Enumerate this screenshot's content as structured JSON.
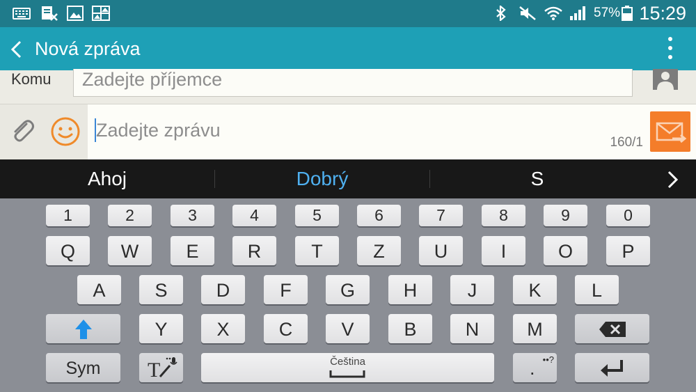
{
  "status_bar": {
    "battery_percent": "57%",
    "time": "15:29",
    "left_icons": [
      "keyboard-icon",
      "document-close-icon",
      "image-icon",
      "gallery-icon"
    ],
    "right_icons": [
      "bluetooth-icon",
      "mute-icon",
      "wifi-icon",
      "signal-icon",
      "battery-icon"
    ]
  },
  "app_bar": {
    "title": "Nová zpráva",
    "accent": "#1ea0b6"
  },
  "recipient": {
    "label": "Komu",
    "placeholder": "Zadejte příjemce"
  },
  "compose": {
    "placeholder": "Zadejte zprávu",
    "counter": "160/1",
    "send_color": "#f47d2a"
  },
  "suggestions": {
    "items": [
      {
        "text": "Ahoj",
        "color": "#ffffff"
      },
      {
        "text": "Dobrý",
        "color": "#4fb0f0"
      },
      {
        "text": "S",
        "color": "#ffffff"
      }
    ]
  },
  "keyboard": {
    "number_row": [
      "1",
      "2",
      "3",
      "4",
      "5",
      "6",
      "7",
      "8",
      "9",
      "0"
    ],
    "row1": [
      "Q",
      "W",
      "E",
      "R",
      "T",
      "Z",
      "U",
      "I",
      "O",
      "P"
    ],
    "row2": [
      "A",
      "S",
      "D",
      "F",
      "G",
      "H",
      "J",
      "K",
      "L"
    ],
    "row3": [
      "Y",
      "X",
      "C",
      "V",
      "B",
      "N",
      "M"
    ],
    "sym_label": "Sym",
    "space_label": "Čeština",
    "punct_key": ".",
    "punct_secondary": "••?"
  }
}
